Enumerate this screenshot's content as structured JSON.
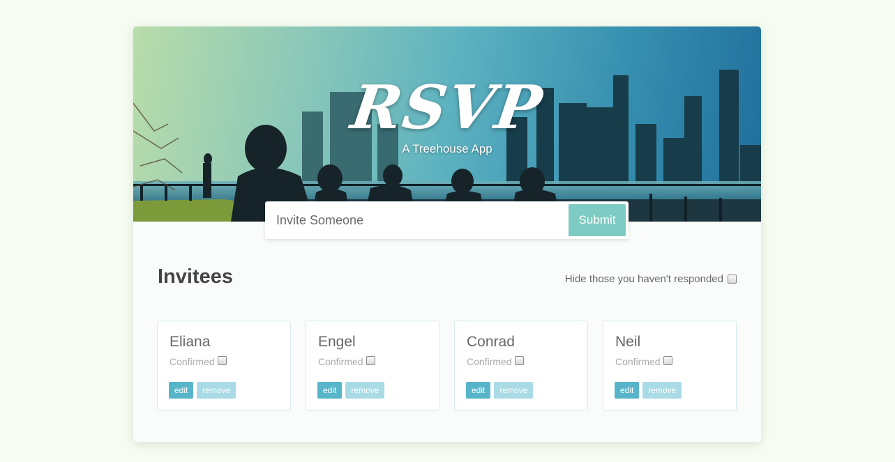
{
  "header": {
    "title": "RSVP",
    "subtitle": "A Treehouse App"
  },
  "invite": {
    "placeholder": "Invite Someone",
    "submit_label": "Submit"
  },
  "invitees": {
    "title": "Invitees",
    "filter_label": "Hide those you haven't responded",
    "confirmed_label": "Confirmed",
    "edit_label": "edit",
    "remove_label": "remove",
    "list": [
      {
        "name": "Eliana",
        "confirmed": false
      },
      {
        "name": "Engel",
        "confirmed": false
      },
      {
        "name": "Conrad",
        "confirmed": false
      },
      {
        "name": "Neil",
        "confirmed": false
      }
    ]
  },
  "colors": {
    "page_bg": "#f6fcf1",
    "submit": "#7dcbc2",
    "edit": "#58b5c9",
    "remove": "#a9dbe6"
  }
}
